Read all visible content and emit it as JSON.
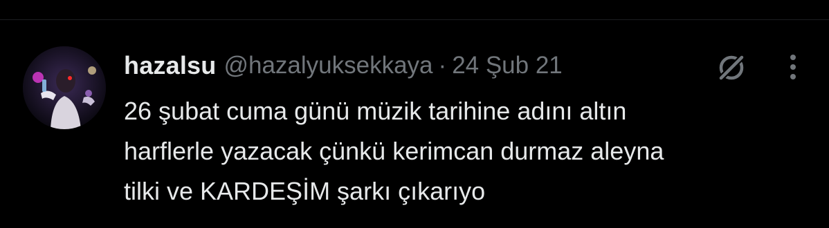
{
  "tweet": {
    "author": {
      "display_name": "hazalsu",
      "handle": "@hazalyuksekkaya",
      "avatar": "profile-photo"
    },
    "separator": "·",
    "timestamp": "24 Şub 21",
    "text_lines": [
      "26 şubat cuma günü müzik tarihine adını altın",
      "harflerle yazacak çünkü kerimcan durmaz aleyna",
      "tilki ve KARDEŞİM şarkı çıkarıyo"
    ],
    "icons": {
      "grok": "grok-icon",
      "more": "more-options-icon"
    }
  },
  "colors": {
    "background": "#000000",
    "text_primary": "#e7e9ea",
    "text_secondary": "#71767b",
    "divider": "#1c1e21"
  }
}
